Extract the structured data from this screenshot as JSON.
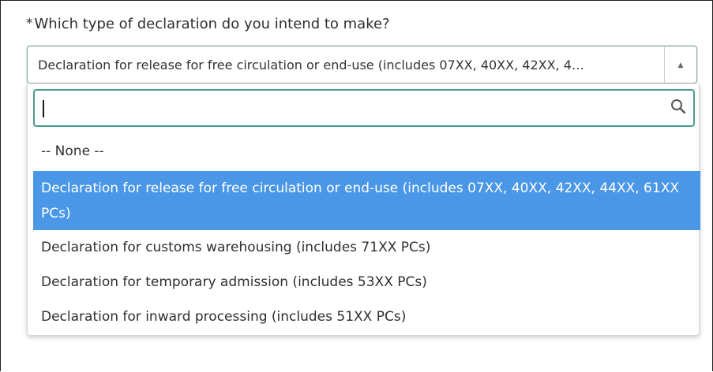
{
  "field": {
    "required_marker": "*",
    "label": "Which type of declaration do you intend to make?"
  },
  "select": {
    "value": "Declaration for release for free circulation or end-use (includes 07XX, 40XX, 42XX, 4…",
    "arrow_icon": "triangle-up-icon",
    "expanded": true
  },
  "search": {
    "value": "",
    "icon": "search-icon"
  },
  "options": [
    {
      "label": "-- None --",
      "selected": false
    },
    {
      "label": "Declaration for release for free circulation or end-use (includes 07XX, 40XX, 42XX, 44XX, 61XX PCs)",
      "selected": true
    },
    {
      "label": "Declaration for customs warehousing (includes 71XX PCs)",
      "selected": false
    },
    {
      "label": "Declaration for temporary admission (includes 53XX PCs)",
      "selected": false
    },
    {
      "label": "Declaration for inward processing (includes 51XX PCs)",
      "selected": false
    }
  ],
  "colors": {
    "selected_option_bg": "#4a97e7",
    "search_border": "#4a9a8b",
    "text": "#2f2f2f"
  }
}
